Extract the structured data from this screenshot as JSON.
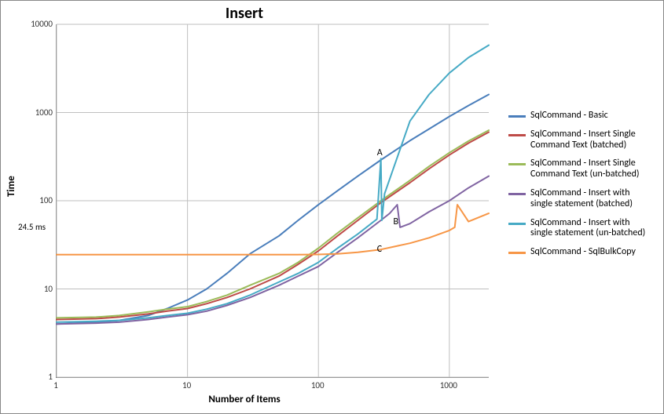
{
  "chart_data": {
    "type": "line",
    "title": "Insert",
    "xlabel": "Number of Items",
    "ylabel": "Time",
    "x_scale": "log",
    "y_scale": "log",
    "xlim": [
      1,
      2000
    ],
    "ylim": [
      1,
      10000
    ],
    "x_ticks": [
      1,
      10,
      100,
      1000
    ],
    "y_ticks": [
      1,
      10,
      100,
      1000,
      10000
    ],
    "extra_y_tick": "24.5 ms",
    "annotations": [
      {
        "label": "A",
        "x": 300,
        "y": 300
      },
      {
        "label": "B",
        "x": 400,
        "y": 50
      },
      {
        "label": "C",
        "x": 300,
        "y": 24.5
      }
    ],
    "series": [
      {
        "name": "SqlCommand - Basic",
        "color": "#4A7EBB",
        "x": [
          1,
          2,
          3,
          5,
          7,
          10,
          14,
          20,
          30,
          50,
          70,
          100,
          140,
          200,
          300,
          500,
          700,
          1000,
          1400,
          2000
        ],
        "y": [
          4,
          4.2,
          4.4,
          5,
          6,
          7.5,
          10,
          15,
          25,
          40,
          60,
          90,
          130,
          190,
          290,
          480,
          650,
          900,
          1200,
          1600
        ]
      },
      {
        "name": "SqlCommand - Insert Single Command Text (batched)",
        "color": "#BE4B48",
        "x": [
          1,
          2,
          3,
          5,
          7,
          10,
          14,
          20,
          30,
          50,
          70,
          100,
          140,
          200,
          300,
          500,
          700,
          1000,
          1400,
          2000
        ],
        "y": [
          4.5,
          4.6,
          4.8,
          5.2,
          5.6,
          6,
          6.8,
          8,
          10,
          14,
          19,
          27,
          40,
          60,
          95,
          160,
          230,
          330,
          450,
          600
        ]
      },
      {
        "name": "SqlCommand - Insert Single Command Text (un-batched)",
        "color": "#9BBB59",
        "x": [
          1,
          2,
          3,
          5,
          7,
          10,
          14,
          20,
          30,
          50,
          70,
          100,
          140,
          200,
          300,
          500,
          700,
          1000,
          1400,
          2000
        ],
        "y": [
          4.7,
          4.8,
          5.0,
          5.5,
          5.9,
          6.3,
          7.2,
          8.5,
          11,
          15,
          20,
          29,
          43,
          64,
          100,
          170,
          245,
          350,
          475,
          630
        ]
      },
      {
        "name": "SqlCommand - Insert with single statement (batched)",
        "color": "#8064A2",
        "x": [
          1,
          2,
          3,
          5,
          7,
          10,
          14,
          20,
          30,
          50,
          70,
          100,
          140,
          200,
          300,
          350,
          400,
          420,
          500,
          700,
          1000,
          1400,
          2000
        ],
        "y": [
          4,
          4.1,
          4.2,
          4.5,
          4.8,
          5.1,
          5.6,
          6.5,
          8,
          11,
          14,
          18,
          26,
          38,
          60,
          72,
          90,
          50,
          55,
          75,
          100,
          140,
          190
        ]
      },
      {
        "name": "SqlCommand - Insert with single statement (un-batched)",
        "color": "#46AAC5",
        "x": [
          1,
          2,
          3,
          5,
          7,
          10,
          14,
          20,
          30,
          50,
          70,
          100,
          140,
          200,
          280,
          300,
          305,
          320,
          500,
          700,
          1000,
          1400,
          2000
        ],
        "y": [
          4.2,
          4.3,
          4.4,
          4.7,
          5.0,
          5.3,
          5.9,
          6.8,
          8.5,
          12,
          15,
          20,
          29,
          42,
          62,
          300,
          60,
          120,
          800,
          1600,
          2800,
          4200,
          5800
        ]
      },
      {
        "name": "SqlCommand - SqlBulkCopy",
        "color": "#F79646",
        "x": [
          1,
          2,
          3,
          5,
          7,
          10,
          14,
          20,
          30,
          50,
          70,
          100,
          140,
          200,
          300,
          500,
          700,
          1000,
          1100,
          1150,
          1400,
          2000
        ],
        "y": [
          24.5,
          24.5,
          24.5,
          24.5,
          24.5,
          24.5,
          24.5,
          24.5,
          24.5,
          24.5,
          24.5,
          24.6,
          25,
          26,
          28,
          33,
          38,
          46,
          50,
          90,
          58,
          72
        ]
      }
    ]
  }
}
